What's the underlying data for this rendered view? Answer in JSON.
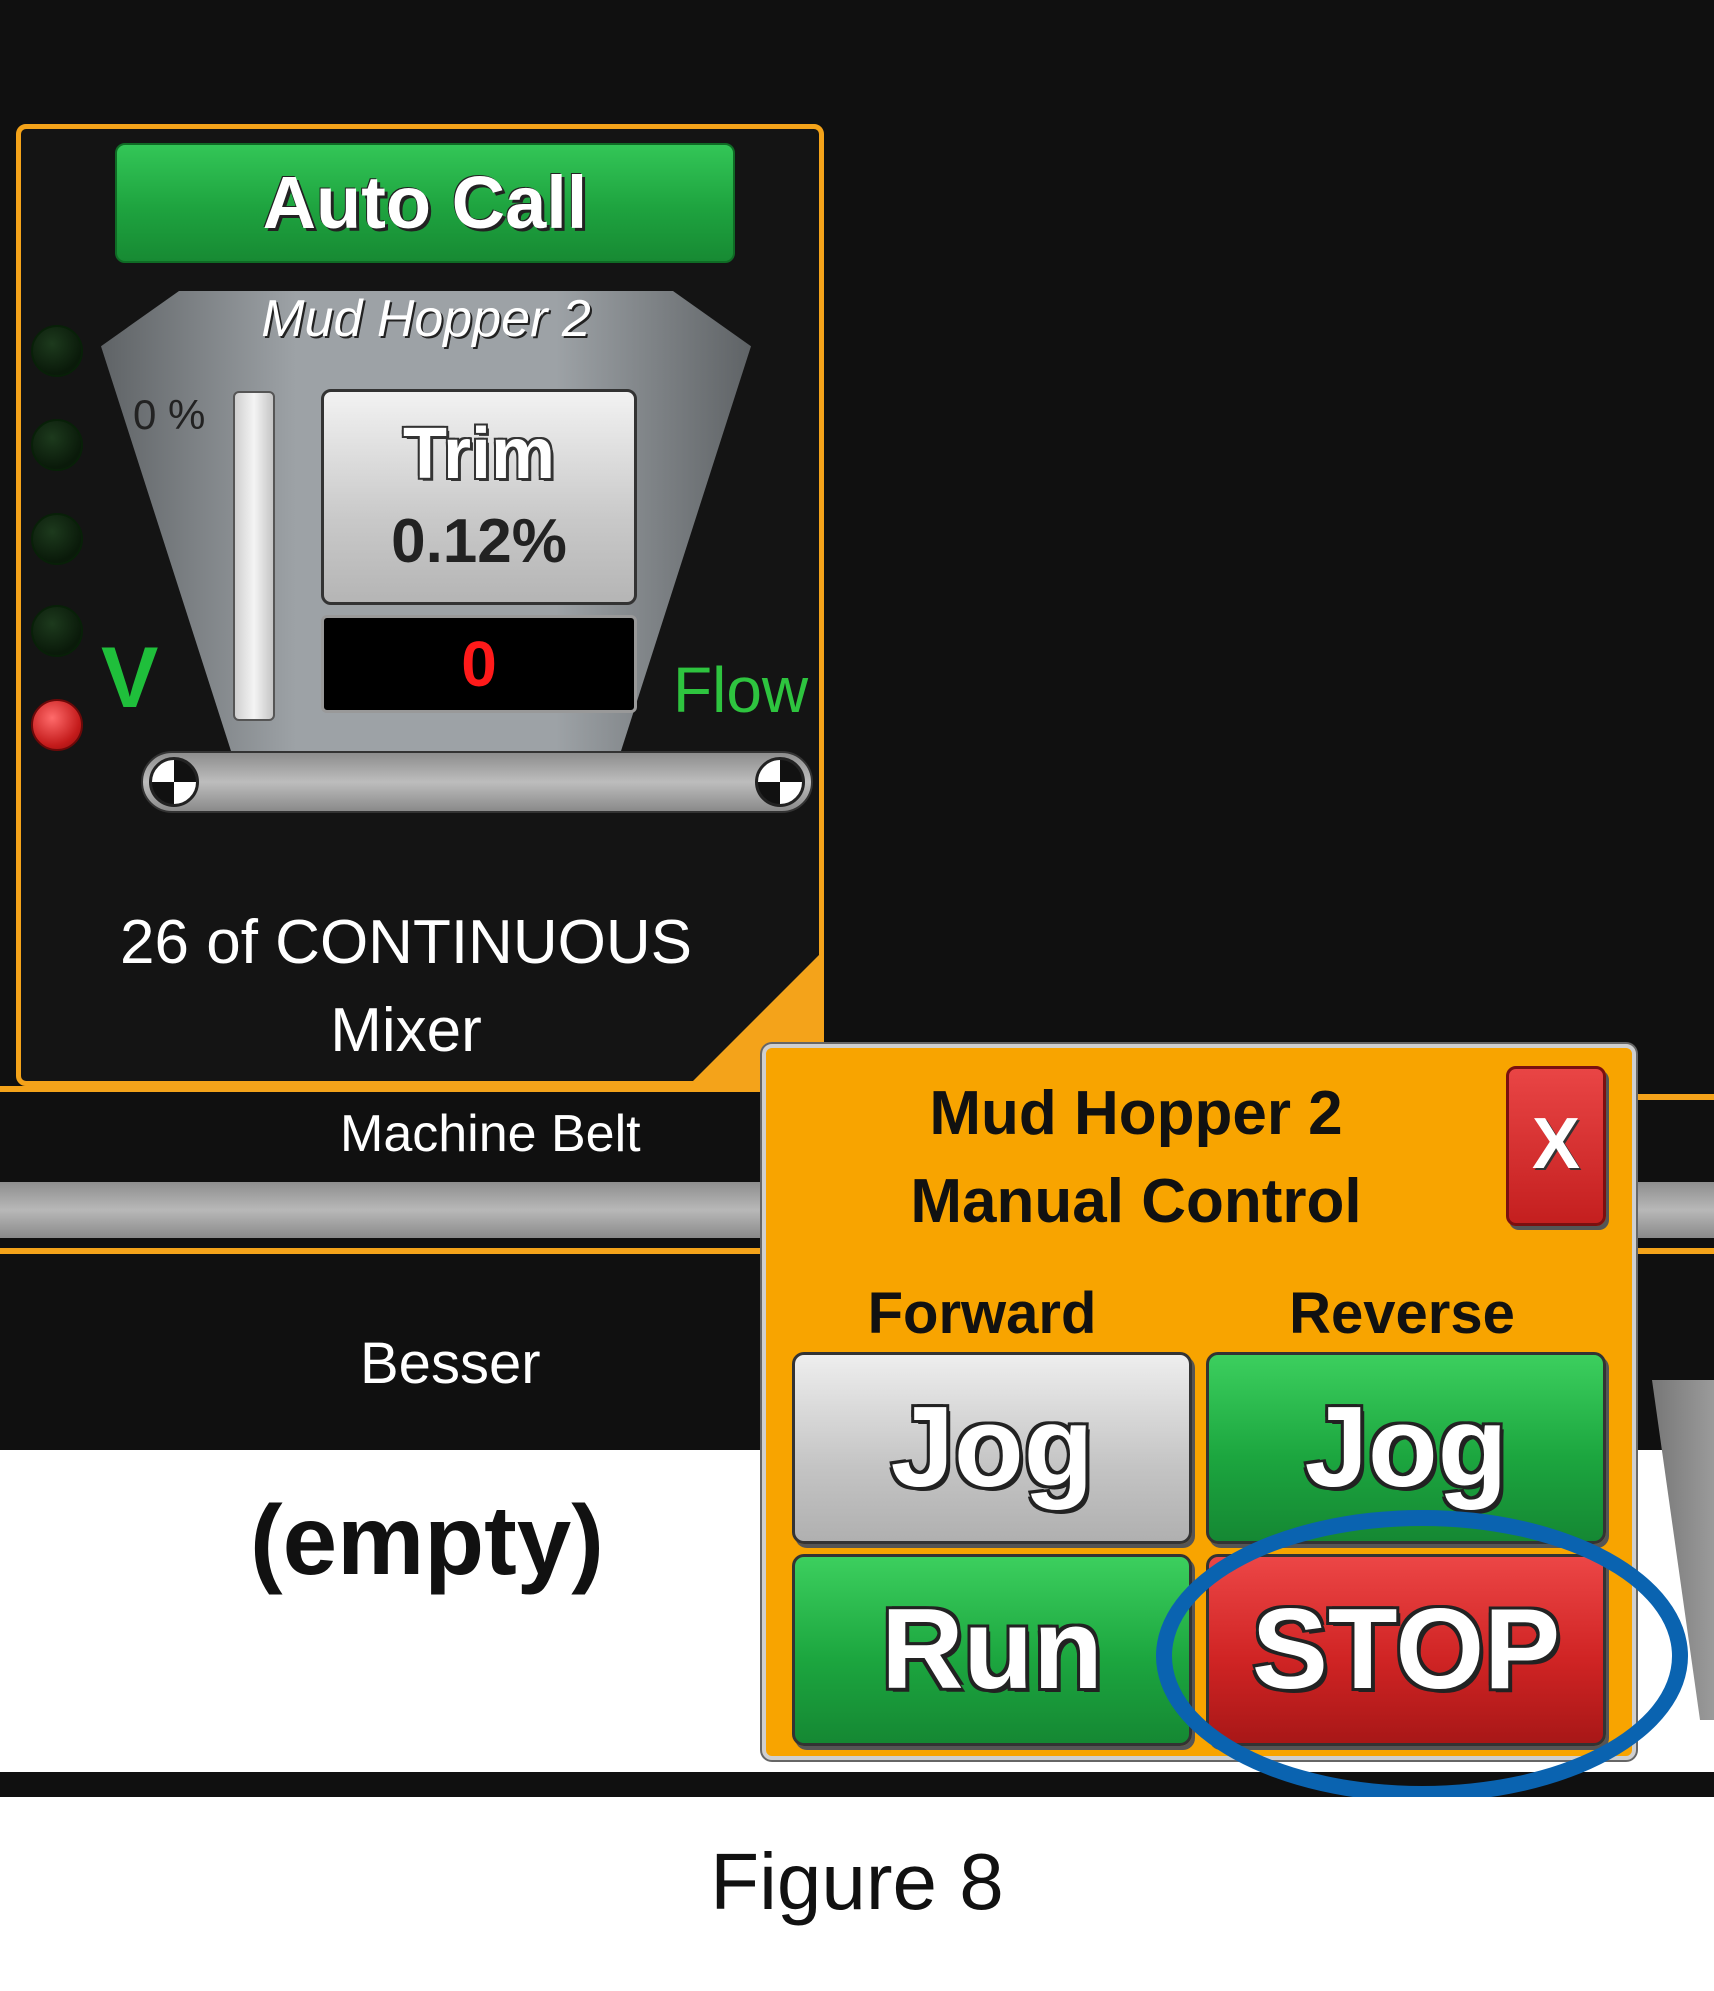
{
  "hopper_card": {
    "auto_call_label": "Auto Call",
    "title": "Mud Hopper 2",
    "level_percent_label": "0 %",
    "trim_label": "Trim",
    "trim_value": "0.12%",
    "count_value": "0",
    "v_label": "V",
    "flow_label": "Flow",
    "mode_text": "26 of CONTINUOUS",
    "destination": "Mixer",
    "level_fraction": 0,
    "led_states": [
      "off",
      "off",
      "off",
      "off",
      "red"
    ]
  },
  "background": {
    "machine_belt_label": "Machine Belt",
    "besser_label": "Besser",
    "empty_label": "(empty)"
  },
  "manual_control": {
    "title_line1": "Mud Hopper 2",
    "title_line2": "Manual Control",
    "close_label": "X",
    "forward_label": "Forward",
    "reverse_label": "Reverse",
    "forward_jog_label": "Jog",
    "reverse_jog_label": "Jog",
    "run_label": "Run",
    "stop_label": "STOP"
  },
  "caption": "Figure 8",
  "colors": {
    "card_border": "#f4a31a",
    "popup_background": "#f8a400",
    "active_green": "#1ea33f",
    "stop_red": "#d02424",
    "highlight_ring": "#0a63b0",
    "count_text": "#ff1a1a"
  }
}
